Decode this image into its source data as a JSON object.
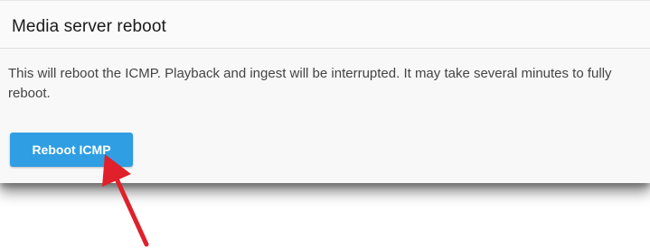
{
  "panel": {
    "title": "Media server reboot",
    "description": "This will reboot the ICMP. Playback and ingest will be interrupted. It may take several minutes to fully reboot.",
    "button_label": "Reboot ICMP"
  },
  "colors": {
    "button_background": "#2f9ee3",
    "annotation_arrow": "#e0202a"
  },
  "icons": {
    "annotation": "red-arrow-icon"
  }
}
